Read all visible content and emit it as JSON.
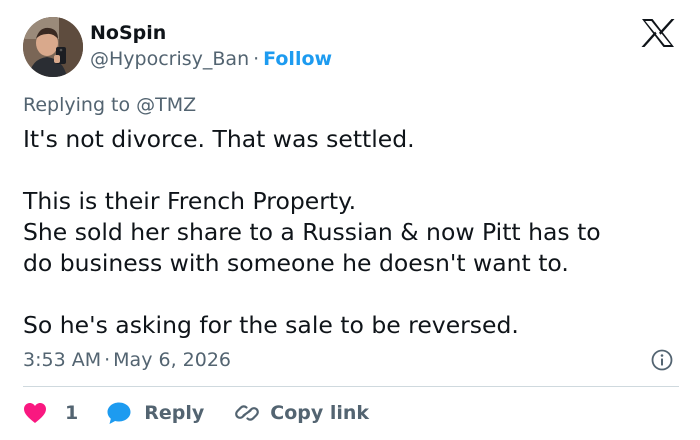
{
  "author": {
    "name": "NoSpin",
    "handle": "@Hypocrisy_Ban",
    "separator": "·",
    "follow_label": "Follow"
  },
  "replying": {
    "prefix": "Replying to",
    "mention": "@TMZ"
  },
  "tweet": {
    "lines": [
      "It's not divorce. That was settled.",
      "This is their French Property.",
      "She sold her share to a Russian & now Pitt has to",
      "do business with someone he doesn't want to.",
      "So he's asking for the sale to be reversed."
    ]
  },
  "meta": {
    "time": "3:53 AM",
    "separator": "·",
    "date": "May 6, 2026"
  },
  "actions": {
    "like_count": "1",
    "reply_label": "Reply",
    "copy_label": "Copy link"
  },
  "icons": {
    "platform_logo": "x-logo-icon",
    "info": "info-icon",
    "like": "heart-icon",
    "reply": "speech-bubble-icon",
    "copy": "link-icon"
  },
  "colors": {
    "accent": "#1d9bf0",
    "like": "#f91880",
    "text": "#0f1419",
    "secondary": "#536471",
    "divider": "#cfd9de"
  }
}
